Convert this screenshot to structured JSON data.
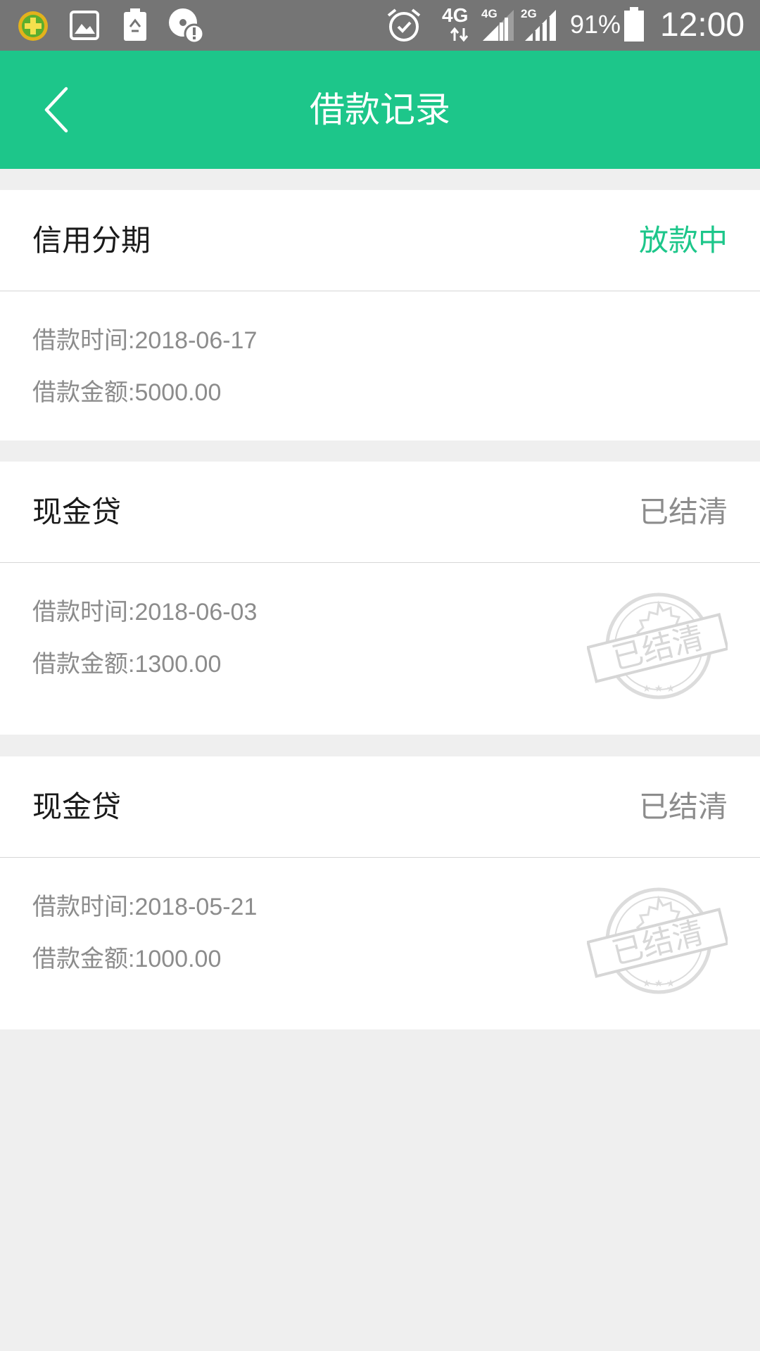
{
  "status_bar": {
    "network_primary": "4G",
    "network_sim1": "4G",
    "network_sim2": "2G",
    "battery_percent": "91%",
    "time": "12:00",
    "icons": [
      "app-notification-icon",
      "image-icon",
      "battery-saver-icon",
      "alert-icon",
      "alarm-icon",
      "signal-icon",
      "battery-icon"
    ]
  },
  "header": {
    "title": "借款记录",
    "back_icon": "chevron-left-icon"
  },
  "colors": {
    "accent": "#1dc68a",
    "status_bar": "#757575",
    "background": "#efefef",
    "muted_text": "#8c8c8c"
  },
  "records": [
    {
      "type": "信用分期",
      "status": "放款中",
      "status_kind": "active",
      "date_line": "借款时间:2018-06-17",
      "amount_line": "借款金额:5000.00",
      "stamp": ""
    },
    {
      "type": "现金贷",
      "status": "已结清",
      "status_kind": "done",
      "date_line": "借款时间:2018-06-03",
      "amount_line": "借款金额:1300.00",
      "stamp": "已结清"
    },
    {
      "type": "现金贷",
      "status": "已结清",
      "status_kind": "done",
      "date_line": "借款时间:2018-05-21",
      "amount_line": "借款金额:1000.00",
      "stamp": "已结清"
    }
  ]
}
